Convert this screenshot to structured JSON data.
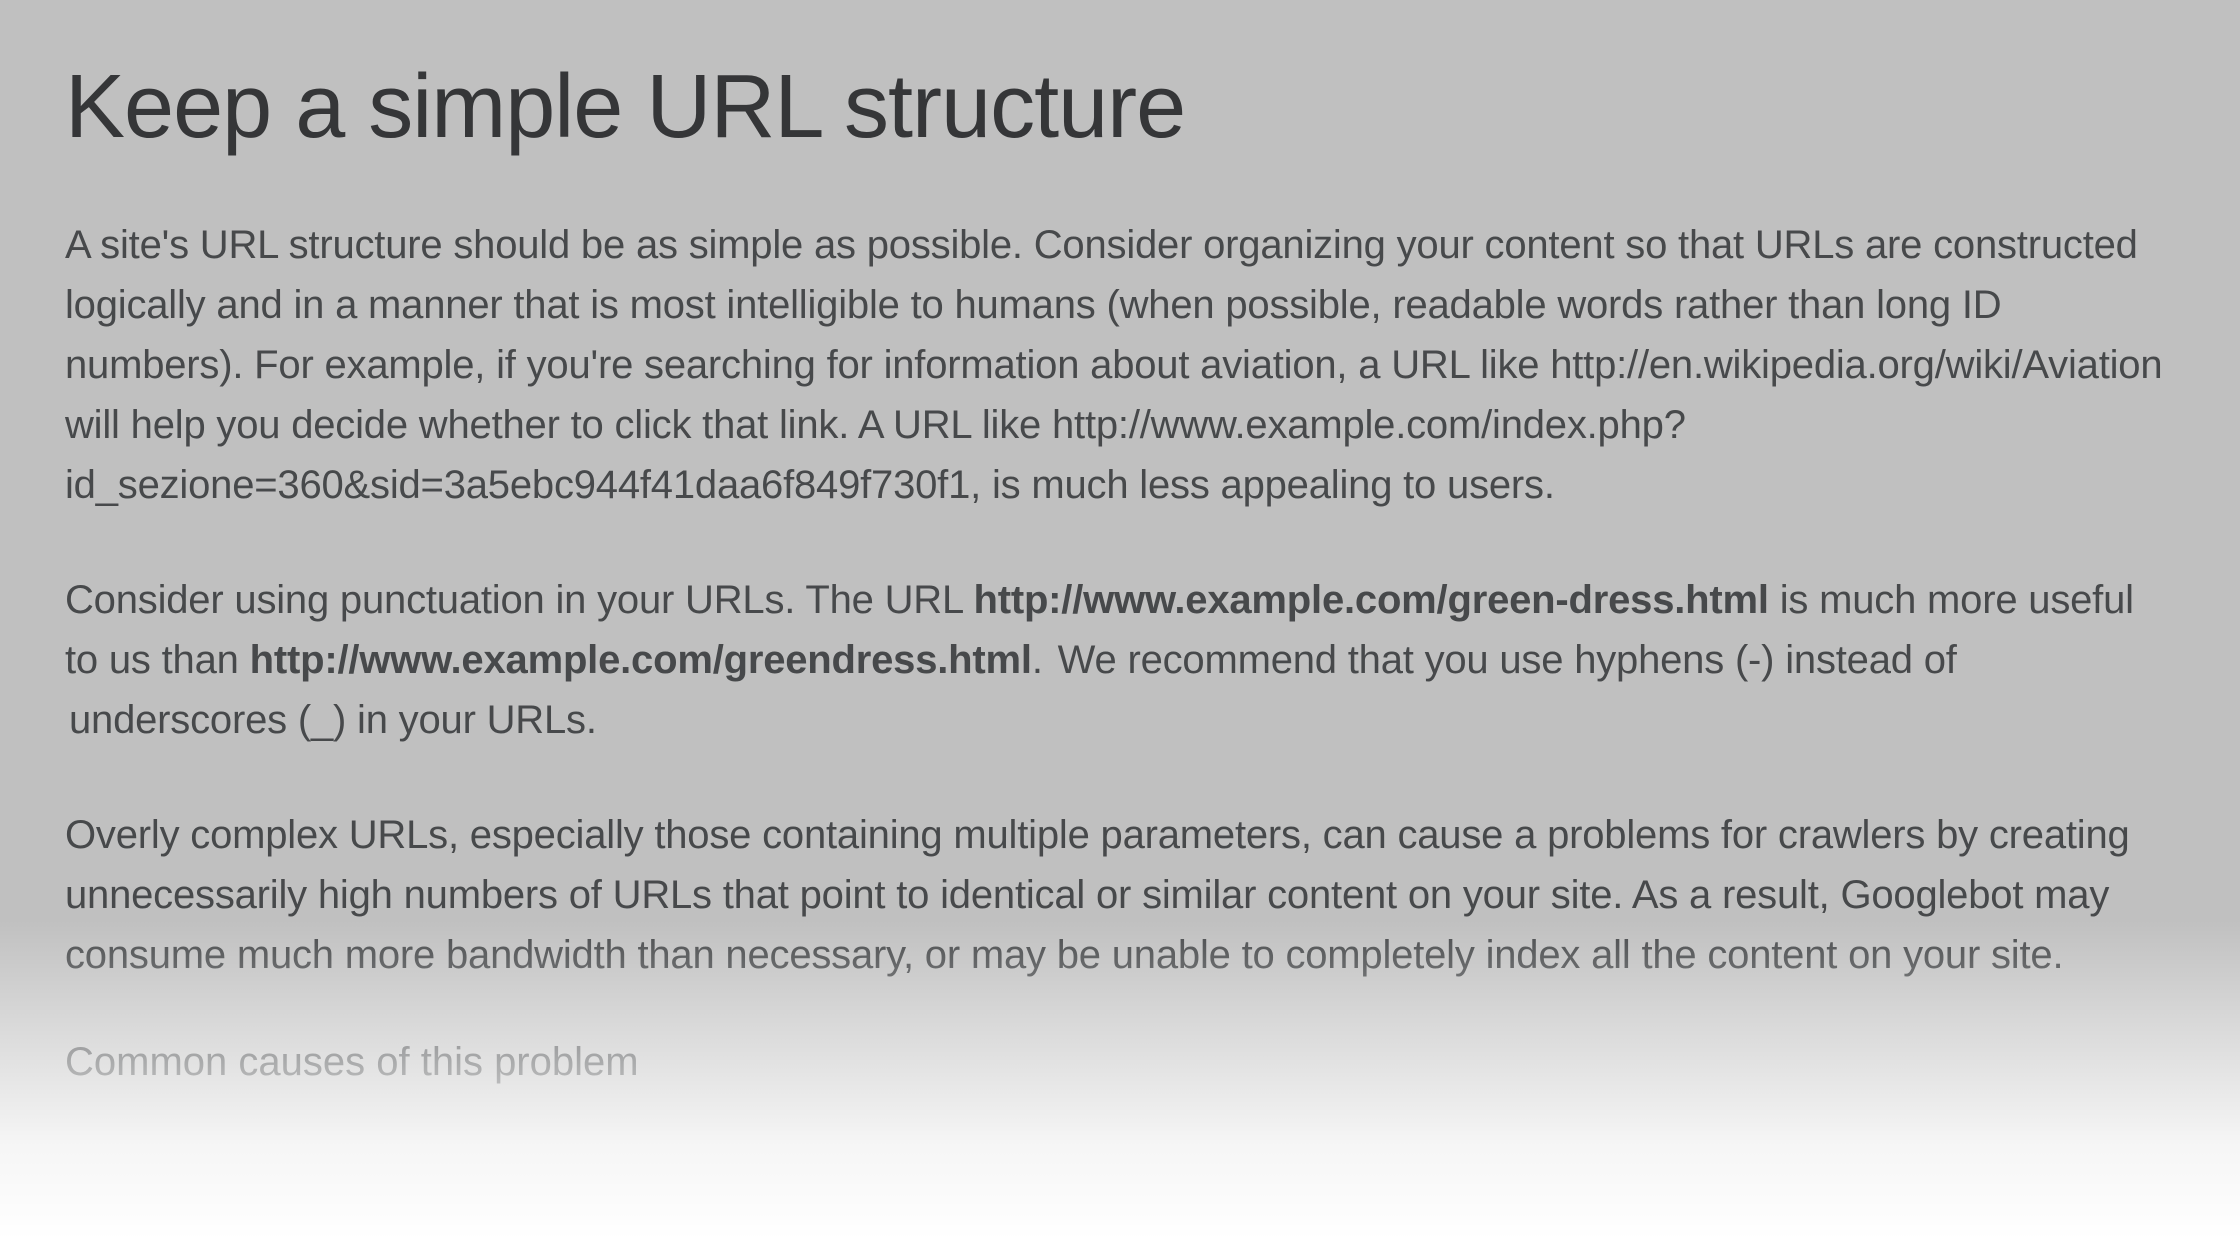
{
  "title": "Keep a simple URL structure",
  "p1": "A site's URL structure should be as simple as possible. Consider organizing your content so that URLs are constructed logically and in a manner that is most intelligible to humans (when possible, readable words rather than long ID numbers). For example, if you're searching for information about aviation, a URL like http://en.wikipedia.org/wiki/Aviation will help you decide whether to click that link. A URL like http://www.example.com/index.php?id_sezione=360&sid=3a5ebc944f41daa6f849f730f1, is much less appealing to users.",
  "p2": {
    "lead": "Consider using punctuation in your URLs. The URL ",
    "bold1": "http://www.example.com/green-dress.html",
    "mid": " is much more useful to us than ",
    "bold2": "http://www.example.com/greendress.html",
    "after_bold": ". ",
    "highlight": "We recommend that you use hyphens (-) instead of underscores (_) in your URLs."
  },
  "p3": "Overly complex URLs, especially those containing multiple parameters, can cause a problems for crawlers by creating unnecessarily high numbers of URLs that point to identical or similar content on your site. As a result, Googlebot may consume much more bandwidth than necessary, or may be unable to completely index all the content on your site.",
  "subhead": "Common causes of this problem"
}
